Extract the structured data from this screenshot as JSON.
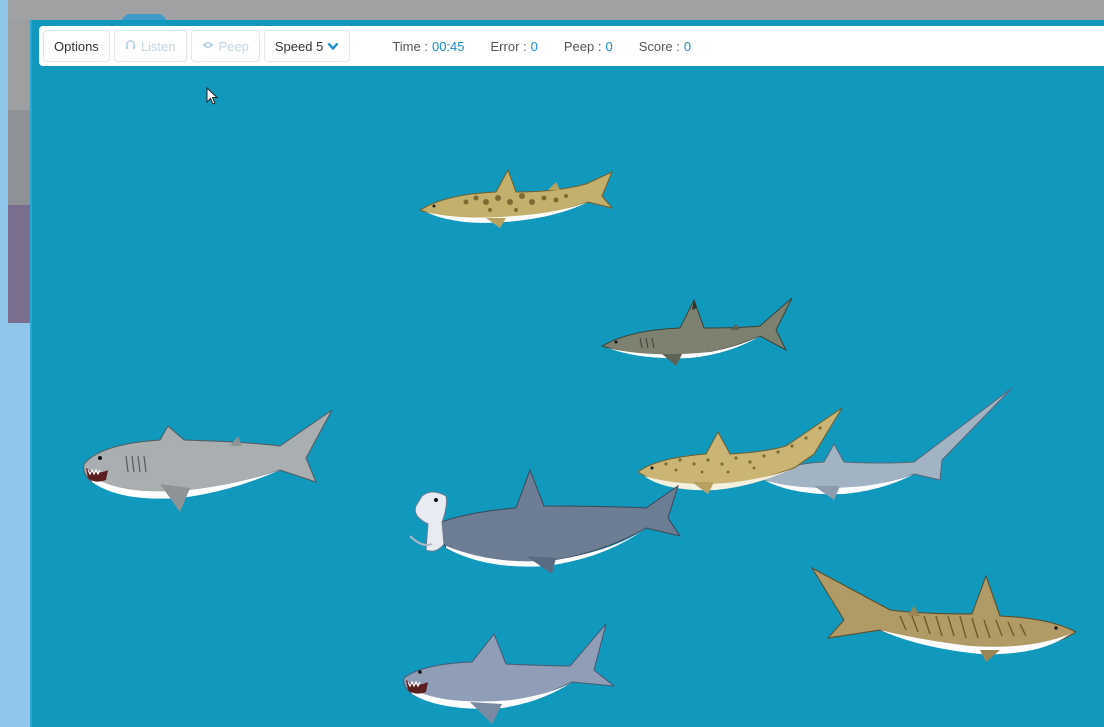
{
  "toolbar": {
    "options_label": "Options",
    "listen_label": "Listen",
    "peep_label": "Peep",
    "speed_label": "Speed 5",
    "stats": {
      "time_label": "Time :",
      "time_value": "00:45",
      "error_label": "Error :",
      "error_value": "0",
      "peep_label": "Peep :",
      "peep_value": "0",
      "score_label": "Score :",
      "score_value": "0"
    }
  },
  "colors": {
    "water": "#1199bd",
    "accent": "#1a8ccf",
    "disabled": "#c2d6e2"
  },
  "icons": {
    "listen": "headphones-icon",
    "peep": "eye-icon",
    "speed": "chevron-down-icon",
    "cursor": "mouse-pointer-icon"
  },
  "sharks": [
    {
      "kind": "leopard shark"
    },
    {
      "kind": "blacktip shark"
    },
    {
      "kind": "great white shark"
    },
    {
      "kind": "zebra shark"
    },
    {
      "kind": "thresher shark"
    },
    {
      "kind": "hammerhead shark"
    },
    {
      "kind": "tiger shark"
    },
    {
      "kind": "great white shark"
    }
  ]
}
